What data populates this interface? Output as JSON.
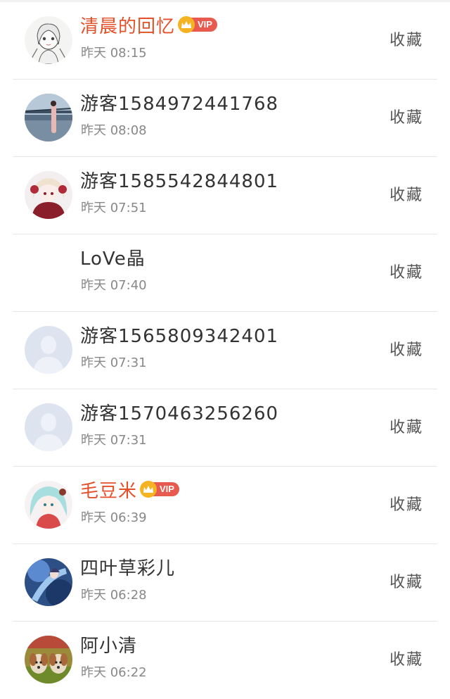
{
  "items": [
    {
      "name": "清晨的回忆",
      "vip": true,
      "vip_label": "VIP",
      "time": "昨天 08:15",
      "action": "收藏",
      "avatar": "anime-girl-sketch"
    },
    {
      "name": "游客1584972441768",
      "vip": false,
      "time": "昨天 08:08",
      "action": "收藏",
      "avatar": "city-photo"
    },
    {
      "name": "游客1585542844801",
      "vip": false,
      "time": "昨天 07:51",
      "action": "收藏",
      "avatar": "anime-girl-red"
    },
    {
      "name": "LoVe晶",
      "vip": false,
      "time": "昨天 07:40",
      "action": "收藏",
      "avatar": "none"
    },
    {
      "name": "游客1565809342401",
      "vip": false,
      "time": "昨天 07:31",
      "action": "收藏",
      "avatar": "default-user"
    },
    {
      "name": "游客1570463256260",
      "vip": false,
      "time": "昨天 07:31",
      "action": "收藏",
      "avatar": "default-user"
    },
    {
      "name": "毛豆米",
      "vip": true,
      "vip_label": "VIP",
      "time": "昨天 06:39",
      "action": "收藏",
      "avatar": "anime-girl-teal"
    },
    {
      "name": "四叶草彩儿",
      "vip": false,
      "time": "昨天 06:28",
      "action": "收藏",
      "avatar": "anime-blue-art"
    },
    {
      "name": "阿小清",
      "vip": false,
      "time": "昨天 06:22",
      "action": "收藏",
      "avatar": "puppies-photo"
    }
  ],
  "colors": {
    "vip_name": "#e3502a",
    "vip_tag": "#e85a4f",
    "crown": "#f5b324",
    "divider": "#e6e6e6"
  }
}
